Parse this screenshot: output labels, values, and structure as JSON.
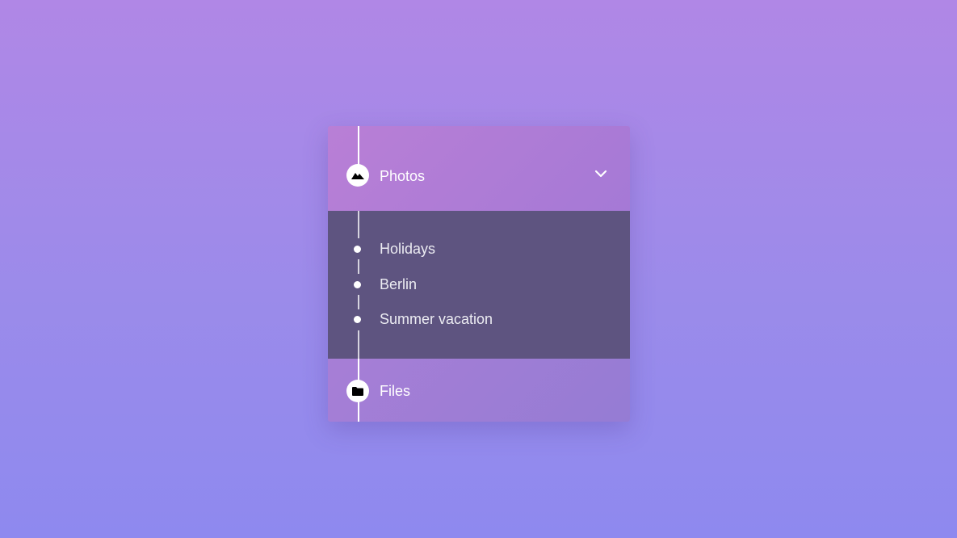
{
  "menu": {
    "photos": {
      "label": "Photos",
      "icon": "mountain-icon",
      "expanded": true,
      "items": [
        {
          "label": "Holidays"
        },
        {
          "label": "Berlin"
        },
        {
          "label": "Summer vacation"
        }
      ]
    },
    "files": {
      "label": "Files",
      "icon": "folder-icon"
    }
  },
  "colors": {
    "background_top": "#b087e6",
    "background_bottom": "#8e89ef",
    "header": "#b07dd6",
    "submenu": "#5e5480",
    "accent": "#ffffff"
  }
}
